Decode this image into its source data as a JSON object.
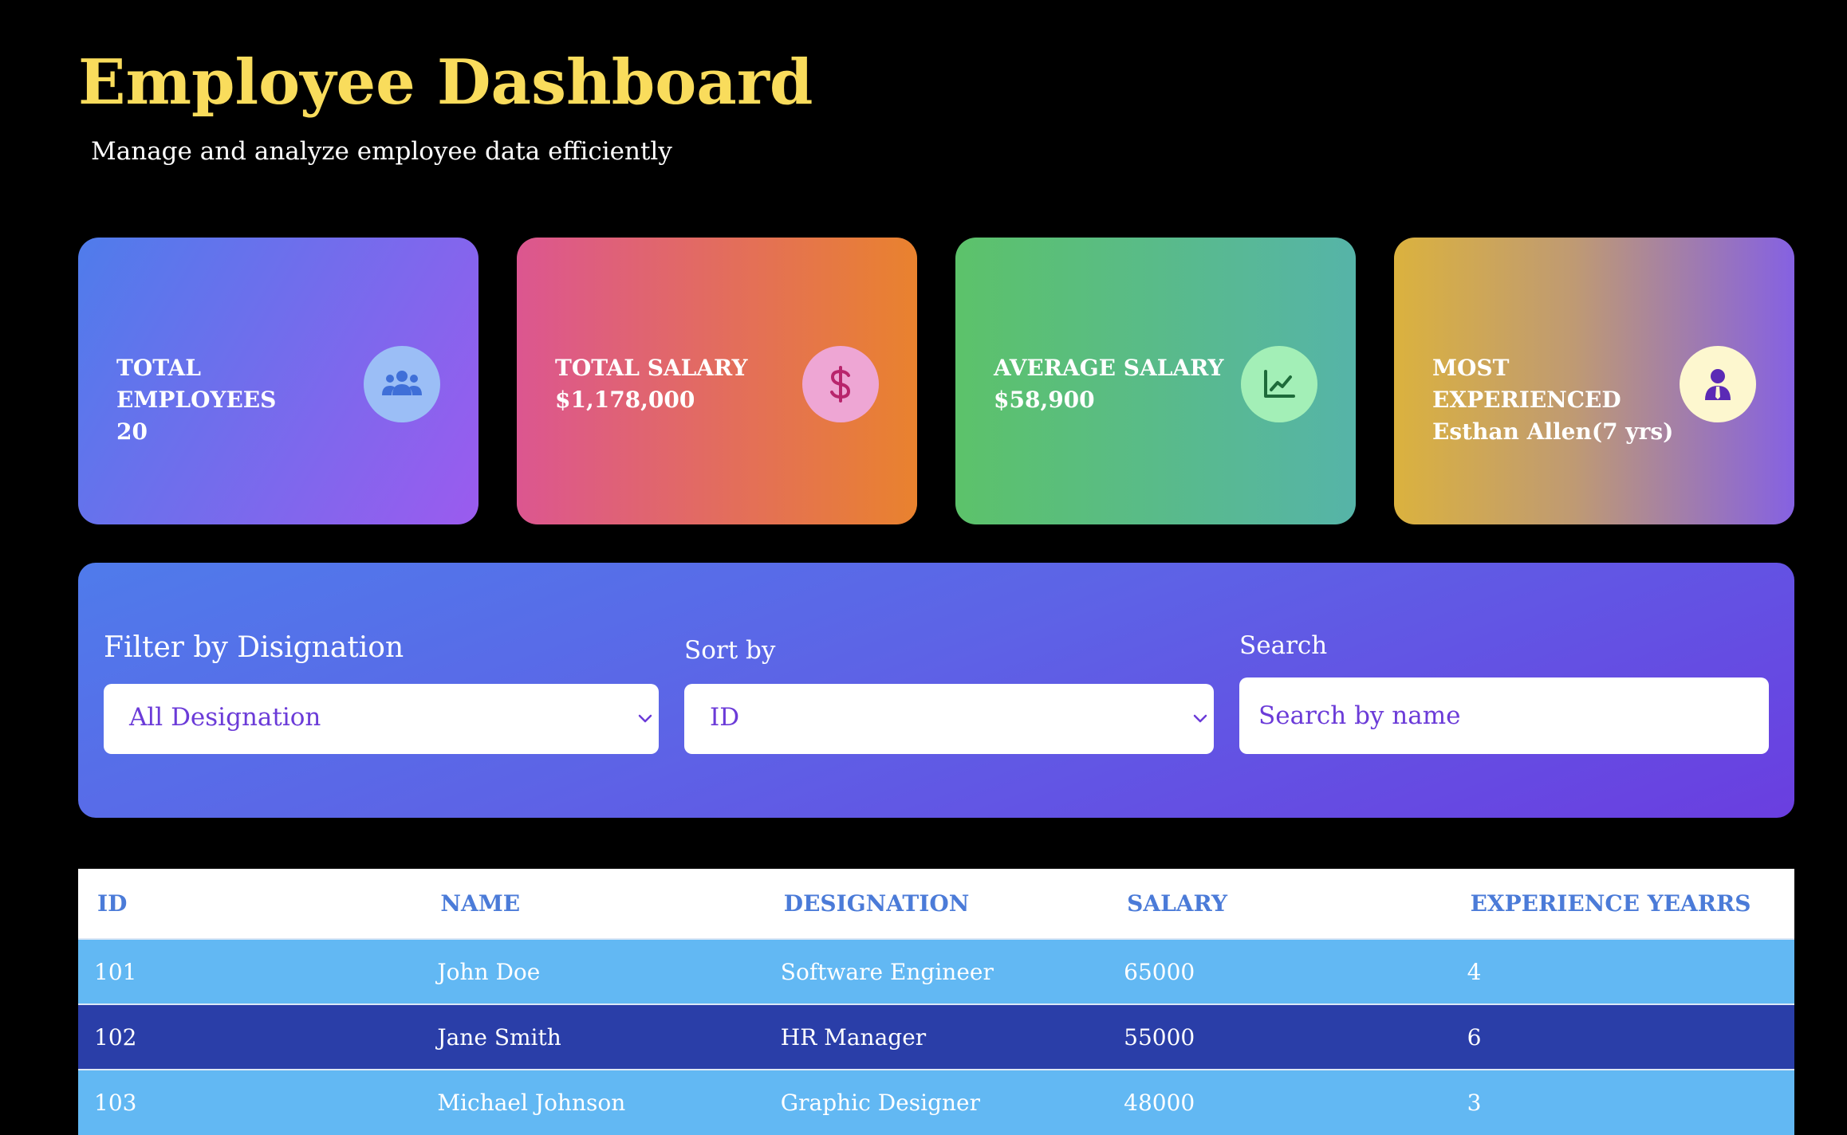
{
  "header": {
    "title": "Employee Dashboard",
    "subtitle": "Manage and analyze employee data efficiently"
  },
  "cards": [
    {
      "label": "Total Employees",
      "value": "20",
      "icon": "users-icon"
    },
    {
      "label": "Total Salary",
      "value": "$1,178,000",
      "icon": "dollar-icon"
    },
    {
      "label": "Average Salary",
      "value": "$58,900",
      "icon": "chart-line-icon"
    },
    {
      "label": "Most Experienced",
      "value": "Esthan Allen(7 yrs)",
      "icon": "user-tie-icon"
    }
  ],
  "filters": {
    "designation_label": "Filter by Disignation",
    "designation_value": "All Designation",
    "sort_label": "Sort by",
    "sort_value": "ID",
    "search_label": "Search",
    "search_placeholder": "Search by name"
  },
  "table": {
    "headers": [
      "ID",
      "NAME",
      "DESIGNATION",
      "SALARY",
      "EXPERIENCE YEARRS"
    ],
    "rows": [
      [
        "101",
        "John Doe",
        "Software Engineer",
        "65000",
        "4"
      ],
      [
        "102",
        "Jane Smith",
        "HR Manager",
        "55000",
        "6"
      ],
      [
        "103",
        "Michael Johnson",
        "Graphic Designer",
        "48000",
        "3"
      ]
    ]
  },
  "colors": {
    "title": "#F9DC5C",
    "accent_purple": "#6B3BD8",
    "table_header_text": "#4B7BD8",
    "row_light": "#62B8F3",
    "row_dark": "#2A3EA8"
  }
}
